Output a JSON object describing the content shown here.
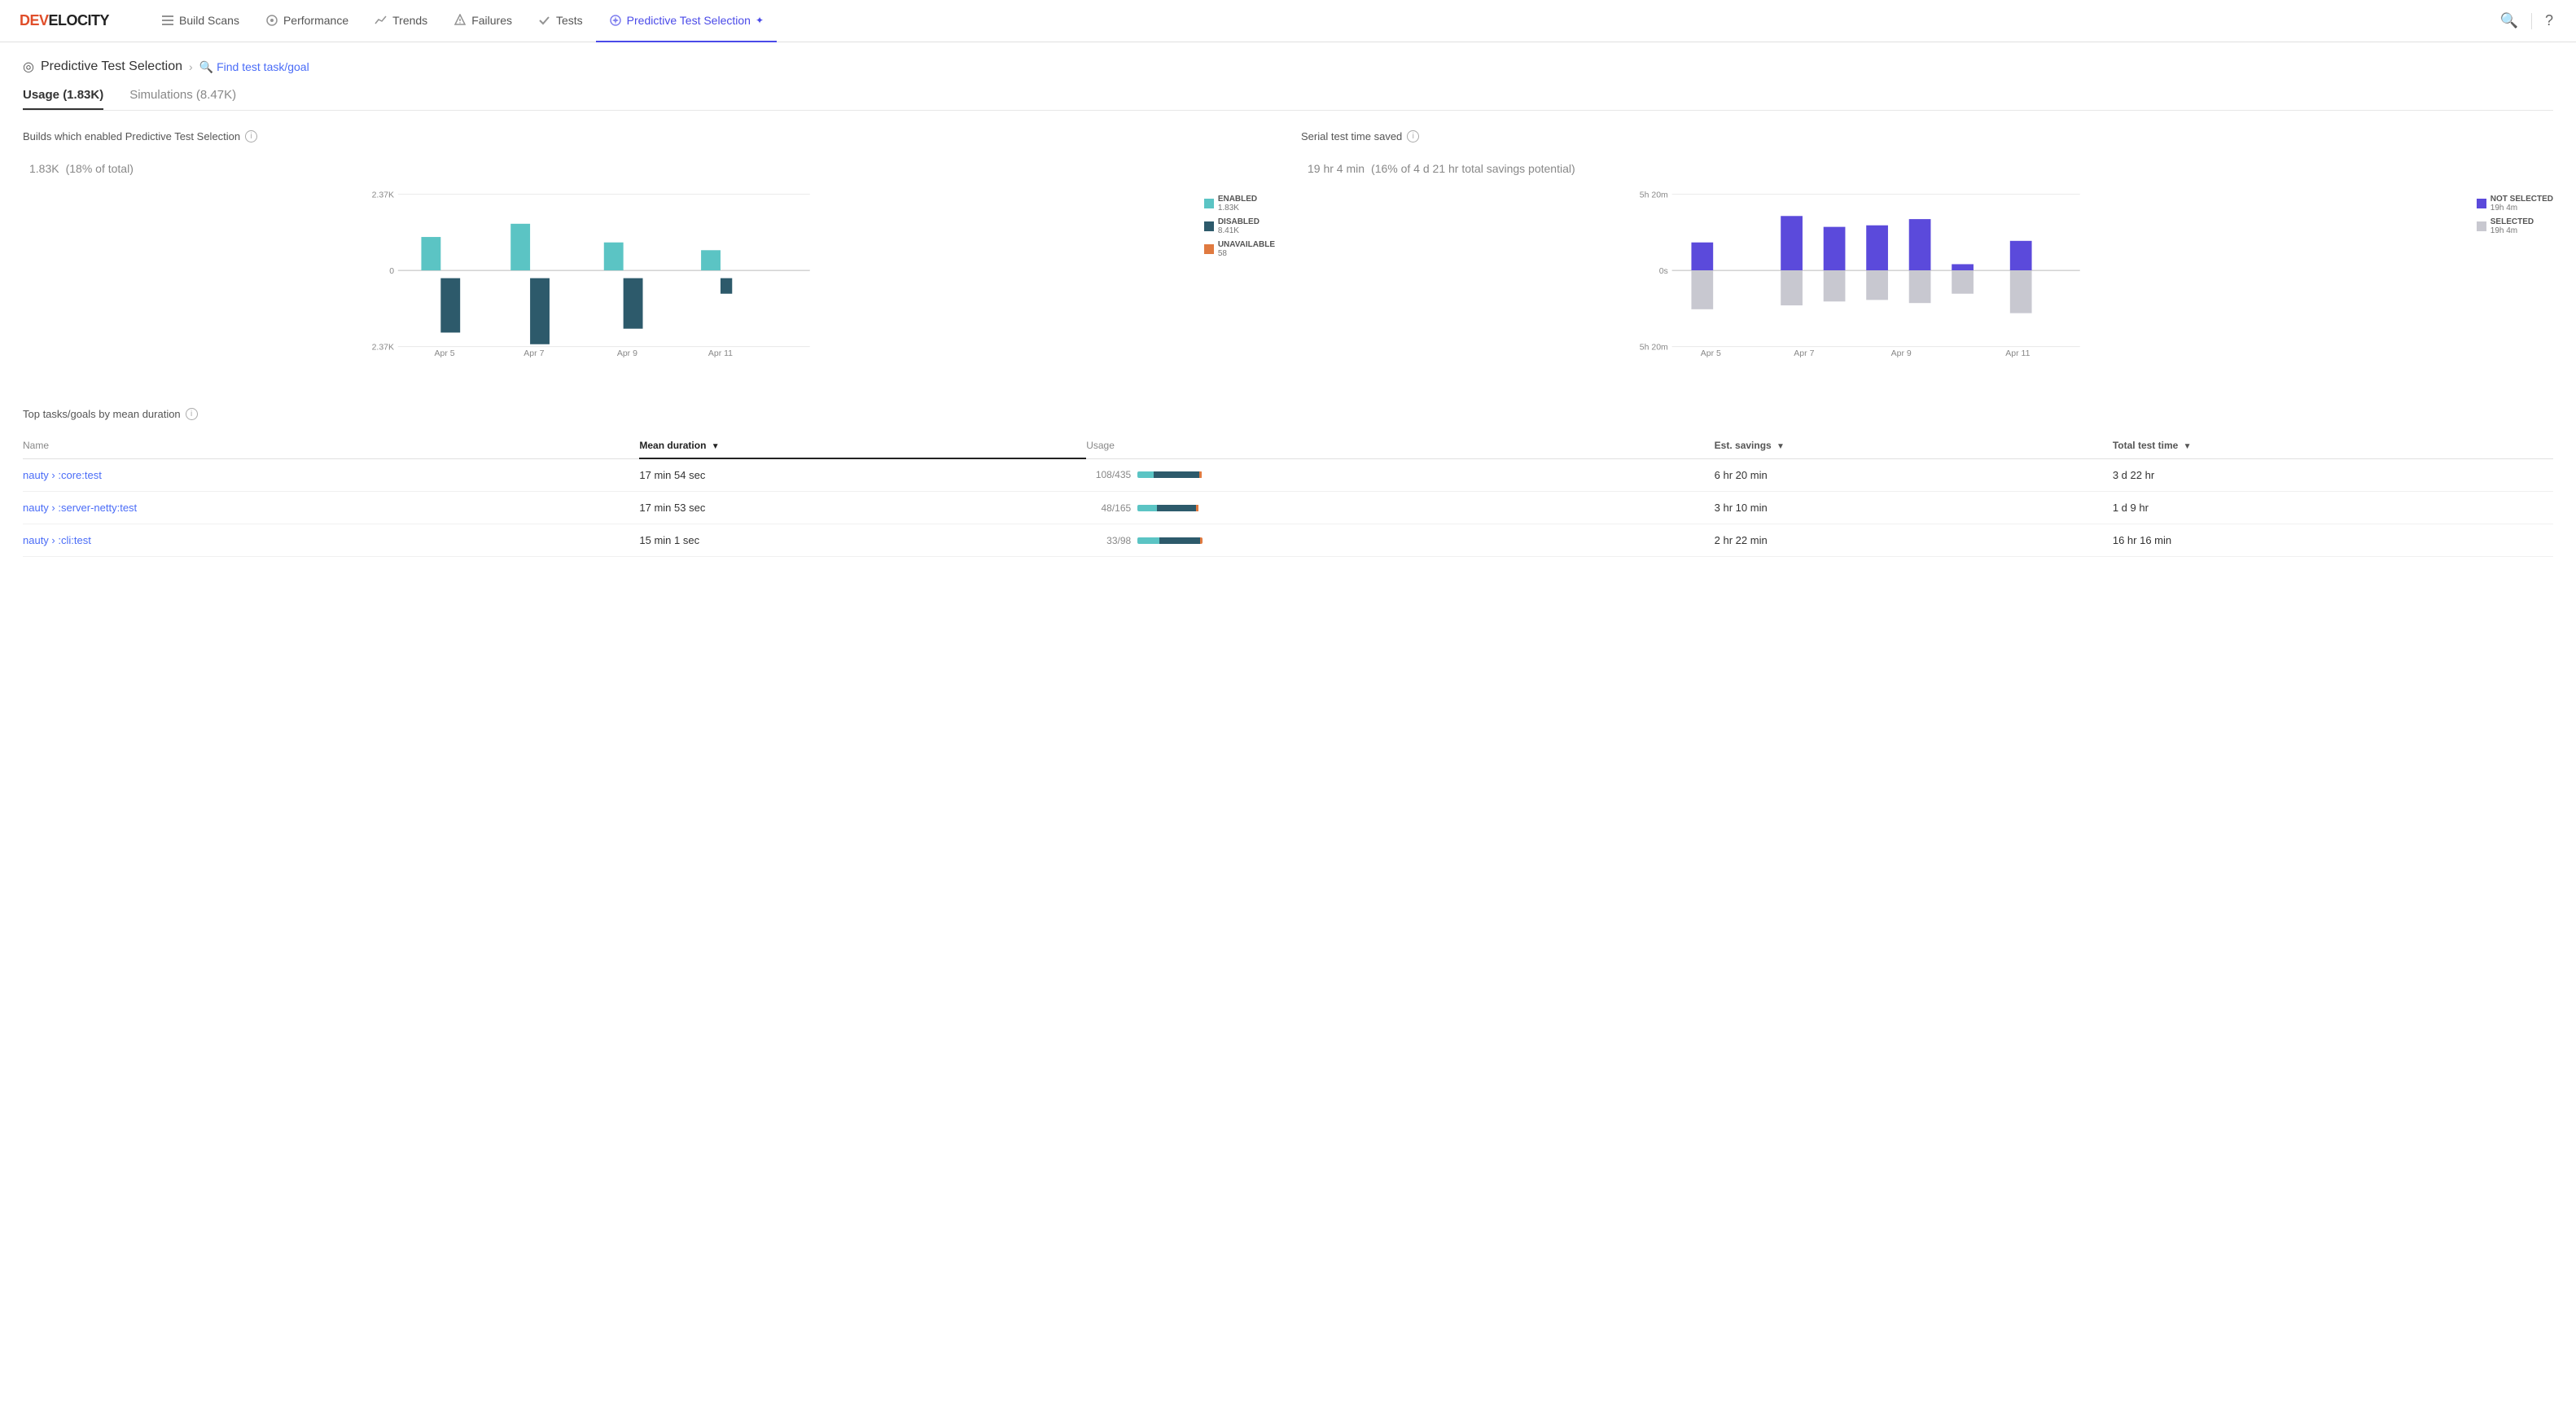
{
  "logo": {
    "prefix": "DEV",
    "suffix": "ELOCITY"
  },
  "nav": {
    "items": [
      {
        "id": "build-scans",
        "label": "Build Scans",
        "icon": "≡",
        "active": false
      },
      {
        "id": "performance",
        "label": "Performance",
        "icon": "◎",
        "active": false
      },
      {
        "id": "trends",
        "label": "Trends",
        "icon": "📈",
        "active": false
      },
      {
        "id": "failures",
        "label": "Failures",
        "icon": "🛡",
        "active": false
      },
      {
        "id": "tests",
        "label": "Tests",
        "icon": "✓",
        "active": false
      },
      {
        "id": "predictive-test-selection",
        "label": "Predictive Test Selection",
        "icon": "✦",
        "active": true
      }
    ],
    "search_icon": "🔍",
    "help_icon": "?"
  },
  "breadcrumb": {
    "icon": "◎",
    "title": "Predictive Test Selection",
    "separator": "›",
    "link_icon": "🔍",
    "link_text": "Find test task/goal"
  },
  "tabs": [
    {
      "id": "usage",
      "label": "Usage (1.83K)",
      "active": true
    },
    {
      "id": "simulations",
      "label": "Simulations (8.47K)",
      "active": false
    }
  ],
  "builds_chart": {
    "title": "Builds which enabled Predictive Test Selection",
    "value": "1.83K",
    "subtitle": "(18% of total)",
    "y_max": "2.37K",
    "y_zero": "0",
    "y_min": "2.37K",
    "x_labels": [
      "Apr 5",
      "Apr 7",
      "Apr 9",
      "Apr 11"
    ],
    "legend": [
      {
        "id": "enabled",
        "label": "ENABLED",
        "value": "1.83K",
        "color": "#5bc4c4"
      },
      {
        "id": "disabled",
        "label": "DISABLED",
        "value": "8.41K",
        "color": "#2d5a6b"
      },
      {
        "id": "unavailable",
        "label": "UNAVAILABLE",
        "value": "58",
        "color": "#e07a40"
      }
    ]
  },
  "serial_chart": {
    "title": "Serial test time saved",
    "value": "19 hr 4 min",
    "subtitle": "(16% of 4 d 21 hr total savings potential)",
    "y_top": "5h 20m",
    "y_zero": "0s",
    "y_bottom": "5h 20m",
    "x_labels": [
      "Apr 5",
      "Apr 7",
      "Apr 9",
      "Apr 11"
    ],
    "legend": [
      {
        "id": "not-selected",
        "label": "NOT SELECTED",
        "value": "19h 4m",
        "color": "#5b4adb"
      },
      {
        "id": "selected",
        "label": "SELECTED",
        "value": "19h 4m",
        "color": "#c8c8d0"
      }
    ]
  },
  "table": {
    "title": "Top tasks/goals by mean duration",
    "columns": [
      {
        "id": "name",
        "label": "Name",
        "sortable": false
      },
      {
        "id": "mean-duration",
        "label": "Mean duration",
        "sortable": true,
        "active": true,
        "sort": "desc"
      },
      {
        "id": "usage",
        "label": "Usage",
        "sortable": false
      },
      {
        "id": "est-savings",
        "label": "Est. savings",
        "sortable": true,
        "active": false,
        "sort": "desc"
      },
      {
        "id": "total-test-time",
        "label": "Total test time",
        "sortable": true,
        "active": false,
        "sort": "desc"
      }
    ],
    "rows": [
      {
        "name": "nauty › :core:test",
        "mean_duration": "17 min 54 sec",
        "usage_ratio": "108/435",
        "usage_bar": {
          "teal": 25,
          "dark": 70,
          "orange": 5
        },
        "est_savings": "6 hr 20 min",
        "total_test_time": "3 d 22 hr"
      },
      {
        "name": "nauty › :server-netty:test",
        "mean_duration": "17 min 53 sec",
        "usage_ratio": "48/165",
        "usage_bar": {
          "teal": 30,
          "dark": 60,
          "orange": 10
        },
        "est_savings": "3 hr 10 min",
        "total_test_time": "1 d 9 hr"
      },
      {
        "name": "nauty › :cli:test",
        "mean_duration": "15 min 1 sec",
        "usage_ratio": "33/98",
        "usage_bar": {
          "teal": 34,
          "dark": 62,
          "orange": 4
        },
        "est_savings": "2 hr 22 min",
        "total_test_time": "16 hr 16 min"
      }
    ]
  }
}
